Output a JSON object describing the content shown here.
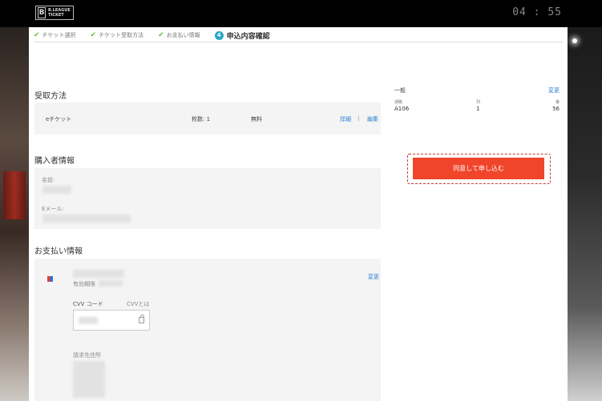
{
  "header": {
    "logo_b": "B",
    "logo_line1": "B.LEAGUE",
    "logo_line2": "TICKET",
    "clock": "04 : 55"
  },
  "steps": [
    {
      "label": "チケット選択",
      "done": true
    },
    {
      "label": "チケット受取方法",
      "done": true
    },
    {
      "label": "お支払い情報",
      "done": true
    },
    {
      "num": "4",
      "label": "申込内容確認",
      "active": true
    }
  ],
  "receive": {
    "title": "受取方法",
    "method": "eチケット",
    "count": "枚数: 1",
    "fee": "無料",
    "detail_link": "詳細",
    "separator": "|",
    "edit_link": "編集"
  },
  "buyer": {
    "title": "購入者情報",
    "name_label": "名前:",
    "email_label": "Eメール:"
  },
  "payment": {
    "title": "お支払い情報",
    "card_expiry_label": "有効期限",
    "change_link": "変更",
    "cvv_label": "CVV コード",
    "cvv_help": "CVVとは",
    "billing_label": "請求先住所"
  },
  "summary": {
    "seat_type": "一般",
    "change_link": "変更",
    "headers": [
      "通路",
      "列",
      "番"
    ],
    "values": [
      "A106",
      "1",
      "56"
    ]
  },
  "submit": {
    "label": "同意して申し込む"
  }
}
